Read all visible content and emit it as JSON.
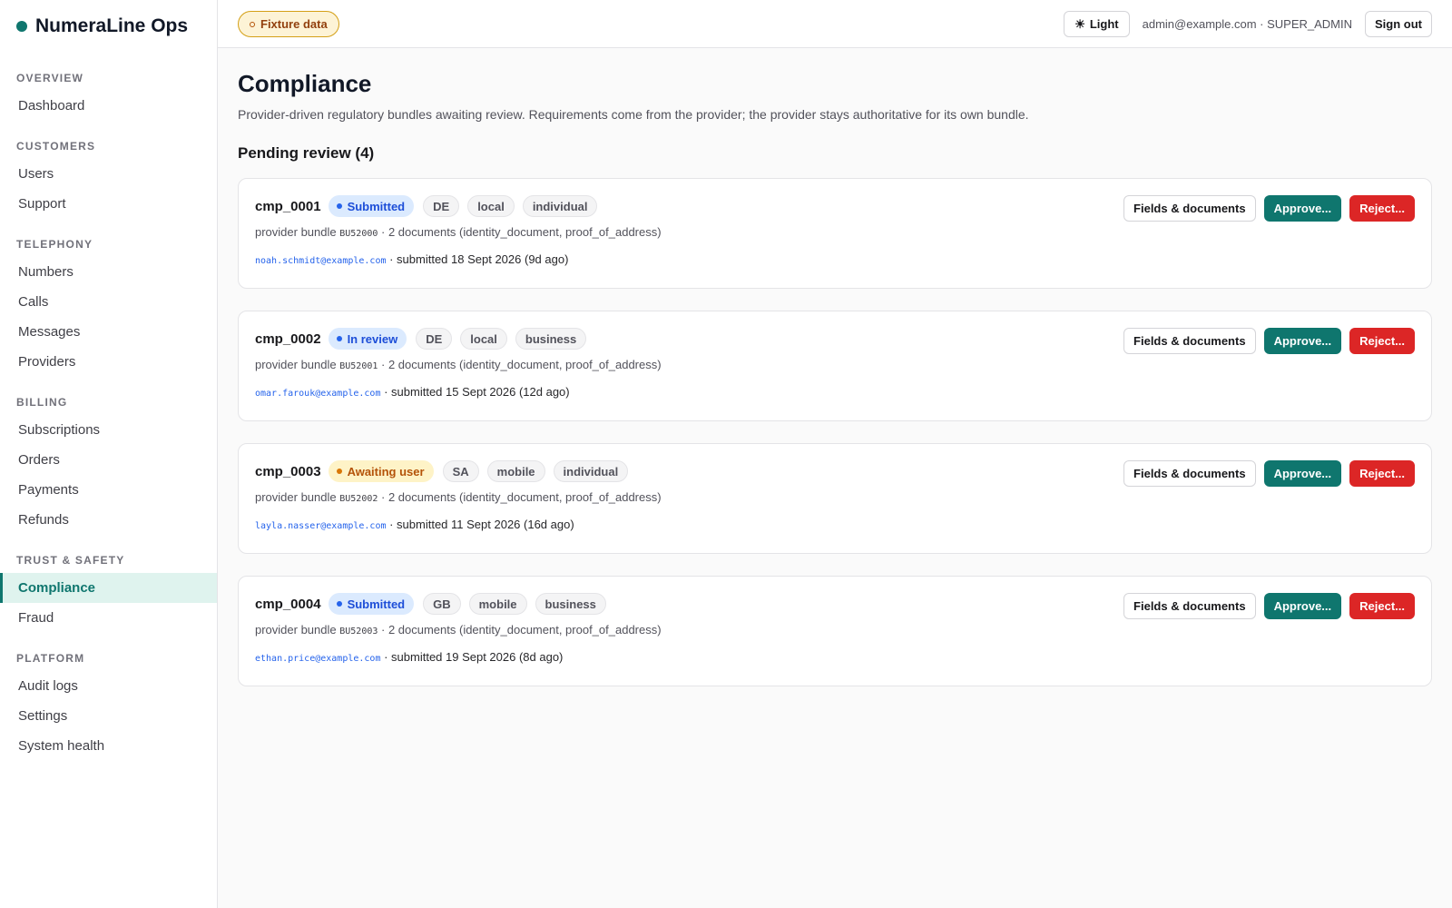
{
  "app": {
    "name": "NumeraLine Ops",
    "brand_color": "#0f766e"
  },
  "sidebar": {
    "sections": [
      {
        "heading": "OVERVIEW",
        "items": [
          "Dashboard"
        ]
      },
      {
        "heading": "CUSTOMERS",
        "items": [
          "Users",
          "Support"
        ]
      },
      {
        "heading": "TELEPHONY",
        "items": [
          "Numbers",
          "Calls",
          "Messages",
          "Providers"
        ]
      },
      {
        "heading": "BILLING",
        "items": [
          "Subscriptions",
          "Orders",
          "Payments",
          "Refunds"
        ]
      },
      {
        "heading": "TRUST & SAFETY",
        "items": [
          "Compliance",
          "Fraud"
        ]
      },
      {
        "heading": "PLATFORM",
        "items": [
          "Audit logs",
          "Settings",
          "System health"
        ]
      }
    ],
    "active_item": "Compliance"
  },
  "topbar": {
    "fixture_label": "Fixture data",
    "theme_label": "Light",
    "theme_icon": "sun-icon",
    "user_info": "admin@example.com · SUPER_ADMIN",
    "signout_label": "Sign out"
  },
  "page": {
    "title": "Compliance",
    "description": "Provider-driven regulatory bundles awaiting review. Requirements come from the provider; the provider stays authoritative for its own bundle.",
    "section_title": "Pending review (4)"
  },
  "actions": {
    "fields_label": "Fields & documents",
    "approve_label": "Approve...",
    "reject_label": "Reject..."
  },
  "status_styles": {
    "Submitted": {
      "bg": "#dbeafe",
      "fg": "#1d4ed8",
      "dot": "#2563eb"
    },
    "In review": {
      "bg": "#dbeafe",
      "fg": "#1d4ed8",
      "dot": "#2563eb"
    },
    "Awaiting user": {
      "bg": "#fef3c7",
      "fg": "#b45309",
      "dot": "#d97706"
    }
  },
  "cases": [
    {
      "id": "cmp_0001",
      "status": "Submitted",
      "tags": [
        "DE",
        "local",
        "individual"
      ],
      "bundle_prefix": "provider bundle ",
      "bundle_id": "BU52000",
      "documents": " · 2 documents (identity_document, proof_of_address)",
      "email": "noah.schmidt@example.com",
      "submitted": " · submitted 18 Sept 2026 (9d ago)"
    },
    {
      "id": "cmp_0002",
      "status": "In review",
      "tags": [
        "DE",
        "local",
        "business"
      ],
      "bundle_prefix": "provider bundle ",
      "bundle_id": "BU52001",
      "documents": " · 2 documents (identity_document, proof_of_address)",
      "email": "omar.farouk@example.com",
      "submitted": " · submitted 15 Sept 2026 (12d ago)"
    },
    {
      "id": "cmp_0003",
      "status": "Awaiting user",
      "tags": [
        "SA",
        "mobile",
        "individual"
      ],
      "bundle_prefix": "provider bundle ",
      "bundle_id": "BU52002",
      "documents": " · 2 documents (identity_document, proof_of_address)",
      "email": "layla.nasser@example.com",
      "submitted": " · submitted 11 Sept 2026 (16d ago)"
    },
    {
      "id": "cmp_0004",
      "status": "Submitted",
      "tags": [
        "GB",
        "mobile",
        "business"
      ],
      "bundle_prefix": "provider bundle ",
      "bundle_id": "BU52003",
      "documents": " · 2 documents (identity_document, proof_of_address)",
      "email": "ethan.price@example.com",
      "submitted": " · submitted 19 Sept 2026 (8d ago)"
    }
  ]
}
